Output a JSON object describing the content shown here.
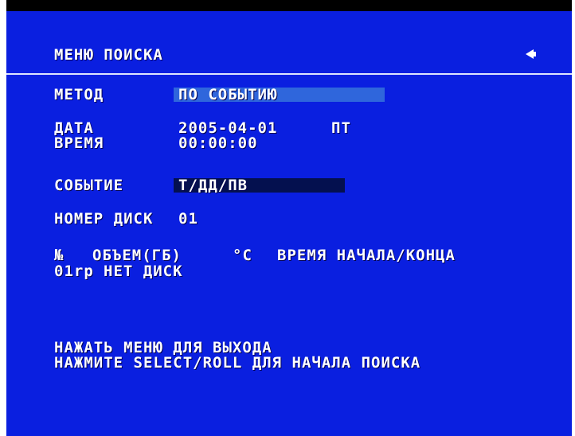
{
  "menu": {
    "title": "МЕНЮ ПОИСКА",
    "back_icon": "triangle-left-icon"
  },
  "method": {
    "label": "МЕТОД",
    "value": "ПО СОБЫТИЮ"
  },
  "datetime": {
    "date_label": "ДАТА",
    "date_value": "2005-04-01",
    "weekday": "ПТ",
    "time_label": "ВРЕМЯ",
    "time_value": "00:00:00"
  },
  "event": {
    "label": "СОБЫТИЕ",
    "value": "Т/ДД/ПВ"
  },
  "disk": {
    "label": "НОМЕР ДИСК",
    "value": "01"
  },
  "table": {
    "columns": [
      "№",
      "ОБЪЕМ(ГБ)",
      "°C",
      "ВРЕМЯ НАЧАЛА/КОНЦА"
    ],
    "rows": [
      [
        "01rp",
        "НЕТ ДИСК"
      ]
    ]
  },
  "help": {
    "line1": "НАЖАТЬ МЕНЮ ДЛЯ ВЫХОДА",
    "line2": "НАЖМИТЕ SELECT/ROLL ДЛЯ НАЧАЛА ПОИСКА"
  },
  "colors": {
    "background": "#0a1fe0",
    "method_highlight": "#2f66dc",
    "event_highlight": "#04104f",
    "text": "#ffffff"
  }
}
